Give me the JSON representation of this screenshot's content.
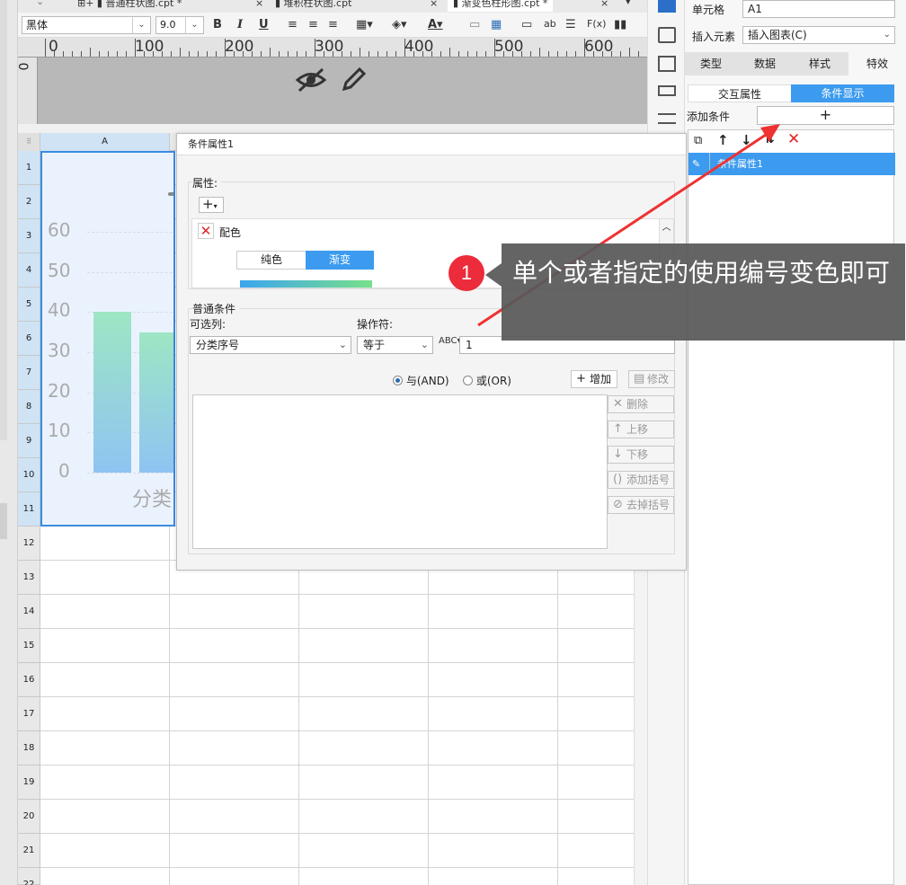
{
  "tabs": [
    {
      "label": "普通柱状图.cpt *"
    },
    {
      "label": "堆积柱状图.cpt"
    },
    {
      "label": "渐变色柱形图.cpt *"
    }
  ],
  "toolbar": {
    "font_family_value": "黑体",
    "font_size_value": "9.0",
    "bold": "B",
    "italic": "I",
    "underline": "U"
  },
  "ruler": {
    "marks": [
      "0",
      "100",
      "200",
      "300",
      "400",
      "500",
      "600"
    ]
  },
  "sheet": {
    "column_a": "A",
    "rows": [
      "1",
      "2",
      "3",
      "4",
      "5",
      "6",
      "7",
      "8",
      "9",
      "10",
      "11",
      "12",
      "13",
      "14",
      "15",
      "16",
      "17",
      "18",
      "19",
      "20",
      "21",
      "22"
    ]
  },
  "chart_data": {
    "type": "bar",
    "y_ticks": [
      "60",
      "50",
      "40",
      "30",
      "20",
      "10",
      "0"
    ],
    "ylim": [
      0,
      60
    ],
    "values": [
      40,
      35
    ],
    "x_label_visible": "分类",
    "colors": {
      "top": "#9ee6c4",
      "bottom": "#8ec4f2"
    }
  },
  "right_panel": {
    "cell_label": "单元格",
    "cell_value": "A1",
    "insert_label": "插入元素",
    "insert_value": "插入图表(C)",
    "tabs": [
      "类型",
      "数据",
      "样式",
      "特效"
    ],
    "active_tab": "特效",
    "subtabs": [
      "交互属性",
      "条件显示"
    ],
    "active_subtab": "条件显示",
    "add_condition_label": "添加条件",
    "add_button": "+",
    "conditions": [
      "条件属性1"
    ]
  },
  "dialog": {
    "title": "条件属性1",
    "attr_label": "属性:",
    "attr_item": "配色",
    "color_tabs": [
      "纯色",
      "渐变"
    ],
    "active_color_tab": "渐变",
    "normal_condition_label": "普通条件",
    "column_label": "可选列:",
    "column_value": "分类序号",
    "operator_label": "操作符:",
    "operator_value": "等于",
    "value_input": "1",
    "radio_and": "与(AND)",
    "radio_or": "或(OR)",
    "buttons": {
      "add": "增加",
      "modify": "修改",
      "delete": "删除",
      "move_up": "上移",
      "move_down": "下移",
      "add_bracket": "添加括号",
      "remove_bracket": "去掉括号"
    }
  },
  "callout": {
    "badge": "1",
    "text": "单个或者指定的使用编号变色即可"
  }
}
